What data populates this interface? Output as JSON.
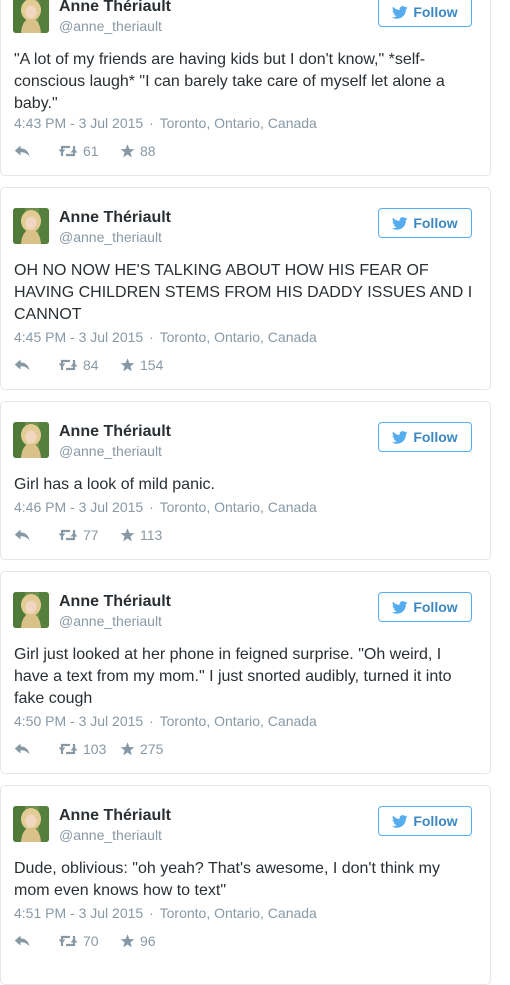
{
  "follow_label": "Follow",
  "accent": "#55acee",
  "icons": {
    "follow": "twitter-bird-icon",
    "reply": "reply-icon",
    "retweet": "retweet-icon",
    "favorite": "star-icon"
  },
  "tweets": [
    {
      "name": "Anne Thériault",
      "handle": "@anne_theriault",
      "text": "\"A lot of my friends are having kids but I don't know,\" *self-conscious laugh* \"I can barely take care of myself let alone a baby.\"",
      "time": "4:43 PM - 3 Jul 2015",
      "location": "Toronto, Ontario, Canada",
      "retweets": "61",
      "favorites": "88"
    },
    {
      "name": "Anne Thériault",
      "handle": "@anne_theriault",
      "text": "OH NO NOW HE'S TALKING ABOUT HOW HIS FEAR OF HAVING CHILDREN STEMS FROM HIS DADDY ISSUES AND I CANNOT",
      "time": "4:45 PM - 3 Jul 2015",
      "location": "Toronto, Ontario, Canada",
      "retweets": "84",
      "favorites": "154"
    },
    {
      "name": "Anne Thériault",
      "handle": "@anne_theriault",
      "text": "Girl has a look of mild panic.",
      "time": "4:46 PM - 3 Jul 2015",
      "location": "Toronto, Ontario, Canada",
      "retweets": "77",
      "favorites": "113"
    },
    {
      "name": "Anne Thériault",
      "handle": "@anne_theriault",
      "text": "Girl just looked at her phone in feigned surprise. \"Oh weird, I have a text from my mom.\" I just snorted audibly, turned it into fake cough",
      "time": "4:50 PM - 3 Jul 2015",
      "location": "Toronto, Ontario, Canada",
      "retweets": "103",
      "favorites": "275"
    },
    {
      "name": "Anne Thériault",
      "handle": "@anne_theriault",
      "text": "Dude, oblivious: \"oh yeah? That's awesome, I don't think my mom even knows how to text\"",
      "time": "4:51 PM - 3 Jul 2015",
      "location": "Toronto, Ontario, Canada",
      "retweets": "70",
      "favorites": "96"
    }
  ]
}
